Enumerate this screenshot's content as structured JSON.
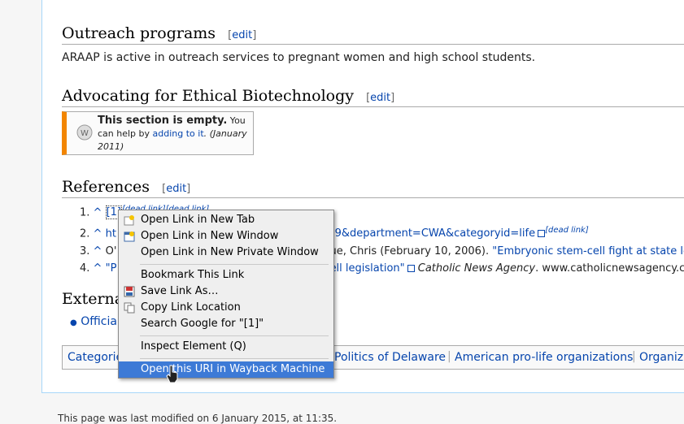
{
  "sections": {
    "outreach": {
      "title": "Outreach programs",
      "edit": "edit",
      "text": "ARAAP is active in outreach services to pregnant women and high school students."
    },
    "advocating": {
      "title": "Advocating for Ethical Biotechnology",
      "edit": "edit"
    },
    "references": {
      "title": "References",
      "edit": "edit"
    },
    "external": {
      "title": "Externa"
    }
  },
  "ambox": {
    "bold": "This section is empty.",
    "text": " You can help by ",
    "link": "adding to it",
    "date": ". (January 2011)"
  },
  "references": {
    "items": [
      {
        "num": "1.",
        "caret": "^",
        "text": "[1]",
        "dead": "[dead link][dead link]"
      },
      {
        "num": "2.",
        "caret": "^",
        "text": "ht",
        "tail": "109&department=CWA&categoryid=life",
        "dead": "[dead link]"
      },
      {
        "num": "3.",
        "caret": "^",
        "text": "O'",
        "tail": "ue, Chris (February 10, 2006).",
        "link": "\"Embryonic stem-cell fight at state le"
      },
      {
        "num": "4.",
        "caret": "^",
        "text": "\"P",
        "tail": "ell legislation\"",
        "agency": "Catholic News Agency",
        "site": ". www.catholicnewsagency.co"
      }
    ]
  },
  "external_links": {
    "first": "Official"
  },
  "categories": {
    "label": "Categorie",
    "items": [
      "Politics of Delaware",
      "American pro-life organizations",
      "Organiza"
    ]
  },
  "footer": {
    "text": "This page was last modified on 6 January 2015, at 11:35."
  },
  "context_menu": {
    "items": [
      {
        "label": "Open Link in New Tab",
        "icon": "new-tab-icon"
      },
      {
        "label": "Open Link in New Window",
        "icon": "new-window-icon"
      },
      {
        "label": "Open Link in New Private Window",
        "icon": ""
      },
      {
        "label": "Bookmark This Link",
        "icon": ""
      },
      {
        "label": "Save Link As…",
        "icon": "save-icon"
      },
      {
        "label": "Copy Link Location",
        "icon": "copy-icon"
      },
      {
        "label": "Search Google for \"[1]\"",
        "icon": ""
      },
      {
        "label": "Inspect Element (Q)",
        "icon": ""
      },
      {
        "label": "Open this URI in Wayback Machine",
        "icon": "",
        "highlighted": true
      }
    ]
  },
  "colors": {
    "link": "#0645ad",
    "highlight": "#3d7ad6",
    "ambox_border": "#f28500"
  }
}
